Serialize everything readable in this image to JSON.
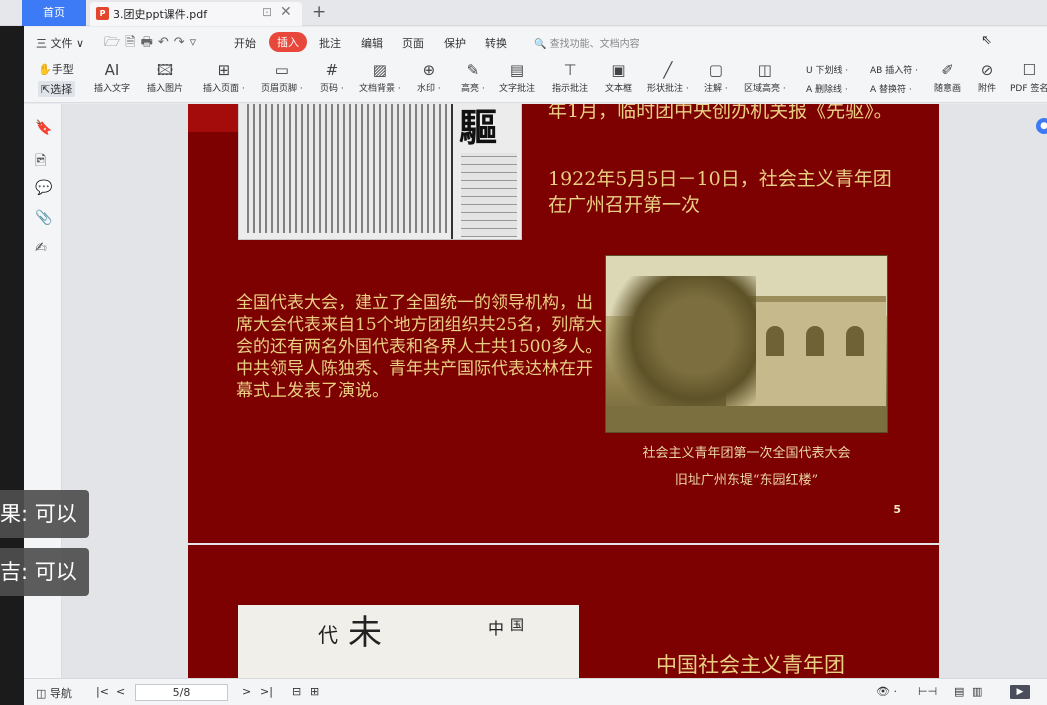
{
  "tabs": {
    "home": "首页",
    "document": "3.团史ppt课件.pdf",
    "new_tab": "+"
  },
  "menu": {
    "file": "三 文件 ∨",
    "tabs": [
      "开始",
      "插入",
      "批注",
      "编辑",
      "页面",
      "保护",
      "转换"
    ],
    "active_tab": "插入",
    "search_placeholder": "查找功能、文档内容"
  },
  "toolbar": {
    "hand": "手型",
    "select": "选择",
    "tools": [
      {
        "icon": "AI",
        "label": "插入文字"
      },
      {
        "icon": "🖾",
        "label": "插入图片"
      },
      {
        "icon": "⊞",
        "label": "插入页面 ·"
      },
      {
        "icon": "▭",
        "label": "页眉页脚 ·"
      },
      {
        "icon": "#",
        "label": "页码 ·"
      },
      {
        "icon": "▨",
        "label": "文档背景 ·"
      },
      {
        "icon": "⊕",
        "label": "水印 ·"
      },
      {
        "icon": "✎",
        "label": "高亮 ·"
      },
      {
        "icon": "▤",
        "label": "文字批注"
      },
      {
        "icon": "⊤",
        "label": "指示批注"
      },
      {
        "icon": "▣",
        "label": "文本框"
      },
      {
        "icon": "╱",
        "label": "形状批注 ·"
      },
      {
        "icon": "▢",
        "label": "注解 ·"
      },
      {
        "icon": "◫",
        "label": "区域高亮 ·"
      }
    ],
    "underline": "U 下划线 ·",
    "strike": "A 删除线 ·",
    "insert_char": "AB 插入符 ·",
    "replace_char": "A 替换符 ·",
    "trailing": [
      {
        "icon": "✐",
        "label": "随意画"
      },
      {
        "icon": "⊘",
        "label": "附件"
      },
      {
        "icon": "☐",
        "label": "PDF 签名"
      }
    ]
  },
  "slide5": {
    "newspaper_title": "驅",
    "text_a": "年1月，临时团中央创办机关报《先驱》。",
    "text_b": "1922年5月5日－10日，社会主义青年团在广州召开第一次",
    "body": "全国代表大会，建立了全国统一的领导机构，出席大会代表来自15个地方团组织共25名，列席大会的还有两名外国代表和各界人士共1500多人。中共领导人陈独秀、青年共产国际代表达林在开幕式上发表了演说。",
    "caption_1": "社会主义青年团第一次全国代表大会",
    "caption_2": "旧址广州东堤“东园红楼”",
    "page_number": "5"
  },
  "slide6": {
    "title": "中国社会主义青年团"
  },
  "overlays": [
    {
      "text": "果: 可以"
    },
    {
      "text": "吉: 可以"
    }
  ],
  "statusbar": {
    "nav": "导航",
    "page": "5/8"
  },
  "colors": {
    "slide_bg": "#7d0101",
    "gold_text": "#e9cf83",
    "accent_blue": "#3d7bf6",
    "active_tab": "#e8473b"
  }
}
